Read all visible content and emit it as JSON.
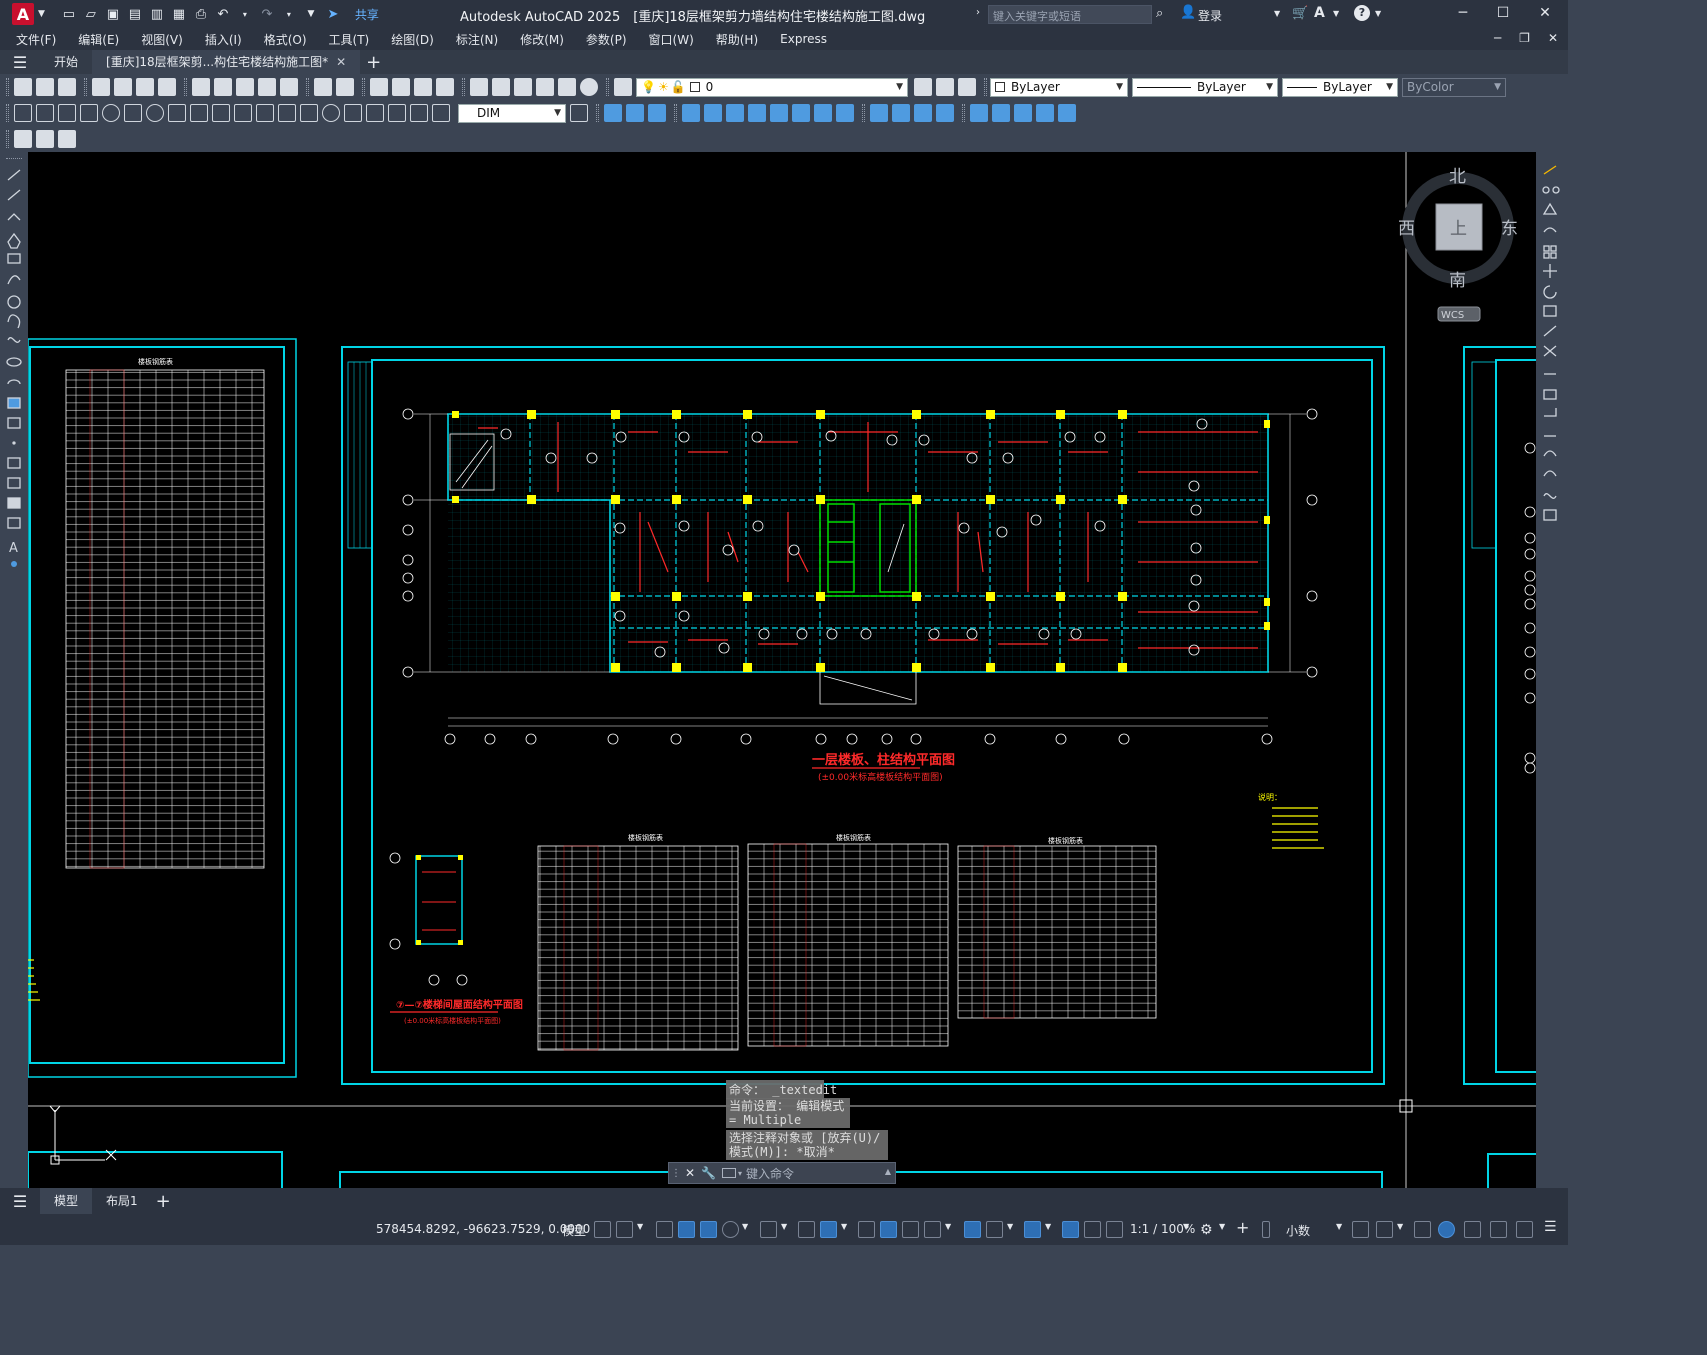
{
  "app": {
    "logo_letter": "A",
    "share_label": "共享",
    "title": "Autodesk AutoCAD 2025　[重庆]18层框架剪力墙结构住宅楼结构施工图.dwg",
    "search_placeholder": "键入关键字或短语",
    "login_label": "登录",
    "win_min": "─",
    "win_max": "☐",
    "win_close": "✕"
  },
  "menu": {
    "items": [
      "文件(F)",
      "编辑(E)",
      "视图(V)",
      "插入(I)",
      "格式(O)",
      "工具(T)",
      "绘图(D)",
      "标注(N)",
      "修改(M)",
      "参数(P)",
      "窗口(W)",
      "帮助(H)",
      "Express"
    ]
  },
  "tabs": {
    "start": "开始",
    "doc": "[重庆]18层框架剪...构住宅楼结构施工图*",
    "close": "✕",
    "add": "+"
  },
  "props": {
    "layer_value": "0",
    "color": "ByLayer",
    "linetype": "ByLayer",
    "lineweight": "ByLayer",
    "plotstyle": "ByColor",
    "dimstyle": "DIM"
  },
  "viewcube": {
    "north": "北",
    "south": "南",
    "east": "东",
    "west": "西",
    "face": "上",
    "wcs": "WCS"
  },
  "drawing": {
    "title": "一层楼板、柱结构平面图",
    "subtitle": "(±0.00米标高楼板结构平面图)",
    "detail_title": "⑦—⑦楼梯间屋面结构平面图",
    "detail_sub": "(±0.00米标高楼板结构平面图)",
    "table1_title": "楼板钢筋表",
    "table2_title": "楼板钢筋表",
    "table3_title": "楼板钢筋表",
    "table4_title": "楼板钢筋表",
    "notes_title": "说明："
  },
  "command": {
    "line1": "命令： _textedit",
    "line2": "当前设置： 编辑模式 = Multiple",
    "line3": "选择注释对象或 [放弃(U)/模式(M)]: *取消*",
    "placeholder": "键入命令"
  },
  "layouts": {
    "model": "模型",
    "layout1": "布局1",
    "add": "+"
  },
  "status": {
    "coords": "578454.8292, -96623.7529, 0.0000",
    "model": "模型",
    "scale": "1:1 / 100%",
    "units": "小数"
  },
  "colors": {
    "cyan": "#00d5e6",
    "red": "#ff2a2a",
    "yellow": "#ffff00",
    "green": "#00e000",
    "accent": "#2e6fb5"
  }
}
